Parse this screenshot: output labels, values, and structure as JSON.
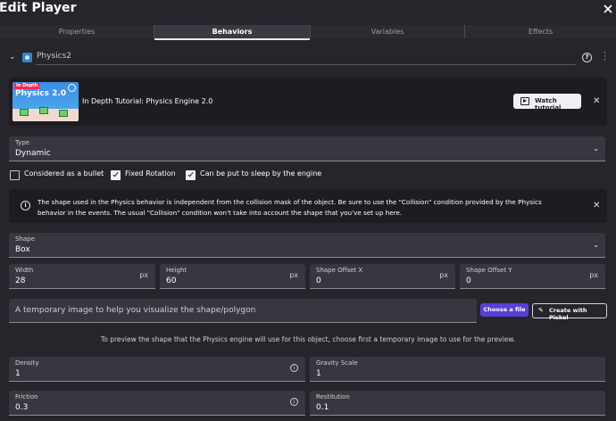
{
  "window": {
    "title": "Edit Player"
  },
  "tabs": [
    {
      "label": "Properties",
      "active": false
    },
    {
      "label": "Behaviors",
      "active": true
    },
    {
      "label": "Variables",
      "active": false
    },
    {
      "label": "Effects",
      "active": false
    }
  ],
  "behavior": {
    "name": "Physics2",
    "help_icon": "help-circle-icon",
    "menu_icon": "more-vert-icon"
  },
  "tutorial": {
    "thumb_tag": "In Depth",
    "thumb_title": "Physics 2.0",
    "title": "In Depth Tutorial: Physics Engine 2.0",
    "watch_label": "Watch tutorial"
  },
  "type_field": {
    "label": "Type",
    "value": "Dynamic"
  },
  "checkboxes": [
    {
      "label": "Considered as a bullet",
      "checked": false
    },
    {
      "label": "Fixed Rotation",
      "checked": true
    },
    {
      "label": "Can be put to sleep by the engine",
      "checked": true
    }
  ],
  "info": {
    "text": "The shape used in the Physics behavior is independent from the collision mask of the object. Be sure to use the \"Collision\" condition provided by the Physics behavior in the events. The usual \"Collision\" condition won't take into account the shape that you've set up here."
  },
  "shape_field": {
    "label": "Shape",
    "value": "Box"
  },
  "dimensions": [
    {
      "label": "Width",
      "value": "28",
      "unit": "px"
    },
    {
      "label": "Height",
      "value": "60",
      "unit": "px"
    },
    {
      "label": "Shape Offset X",
      "value": "0",
      "unit": "px"
    },
    {
      "label": "Shape Offset Y",
      "value": "0",
      "unit": "px"
    }
  ],
  "temp_image": {
    "placeholder": "A temporary image to help you visualize the shape/polygon",
    "choose_label": "Choose a file",
    "piskel_label": "Create with Piskel"
  },
  "preview_note": "To preview the shape that the Physics engine will use for this object, choose first a temporary image to use for the preview.",
  "physics_fields": [
    {
      "label": "Density",
      "value": "1",
      "info": true
    },
    {
      "label": "Gravity Scale",
      "value": "1",
      "info": false
    },
    {
      "label": "Friction",
      "value": "0.3",
      "info": true
    },
    {
      "label": "Restitution",
      "value": "0.1",
      "info": false
    }
  ],
  "colors": {
    "background": "#25252b",
    "field": "#37373f",
    "card": "#1c1c21",
    "accent": "#5a3fd6"
  }
}
